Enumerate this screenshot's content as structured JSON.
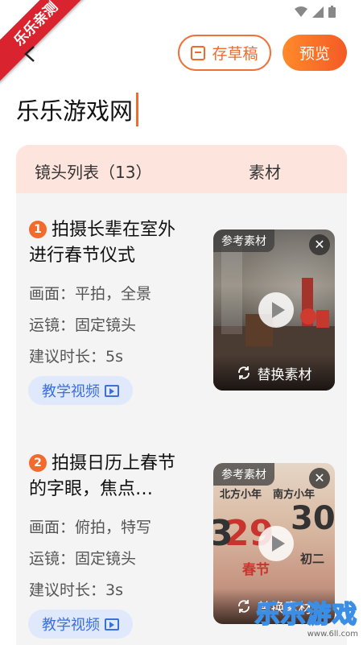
{
  "ribbon": {
    "label": "乐乐亲测"
  },
  "toolbar": {
    "draft_label": "存草稿",
    "preview_label": "预览"
  },
  "title": {
    "value": "乐乐游戏网"
  },
  "panel": {
    "shots_header": "镜头列表（13）",
    "material_header": "素材"
  },
  "shots": [
    {
      "number": "1",
      "title": "拍摄长辈在室外进行春节仪式",
      "frame": "画面：平拍，全景",
      "movement": "运镜：固定镜头",
      "duration": "建议时长：5s",
      "video_label": "教学视频",
      "ref_tag": "参考素材",
      "replace_label": "替换素材"
    },
    {
      "number": "2",
      "title": "拍摄日历上春节的字眼，焦点…",
      "frame": "画面：俯拍，特写",
      "movement": "运镜：固定镜头",
      "duration": "建议时长：3s",
      "video_label": "教学视频",
      "ref_tag": "参考素材",
      "replace_label": "替换素材",
      "calendar_texts": [
        "北方小年",
        "南方小年",
        "29",
        "30",
        "3",
        "春节",
        "初二"
      ]
    }
  ],
  "watermark": {
    "main": "乐乐游戏",
    "sub": "www.6ll.com"
  },
  "colors": {
    "accent": "#f26b2c",
    "blue": "#3c6fd8",
    "panel_header": "#fde5dd"
  }
}
